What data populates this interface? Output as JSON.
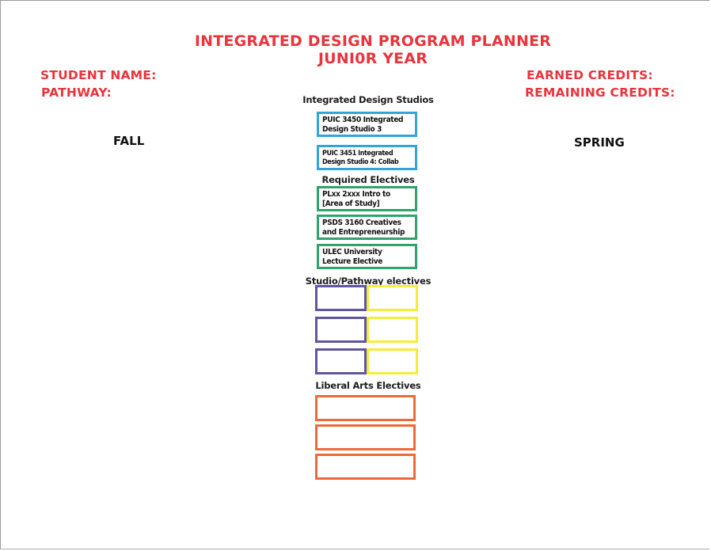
{
  "header": {
    "title": "INTEGRATED DESIGN PROGRAM PLANNER",
    "subtitle": "JUNI0R YEAR"
  },
  "fields": {
    "student_name": "STUDENT NAME:",
    "pathway": "PATHWAY:",
    "earned_credits": "EARNED CREDITS:",
    "remaining_credits": "REMAINING CREDITS:"
  },
  "terms": {
    "fall": "FALL",
    "spring": "SPRING"
  },
  "sections": {
    "studios": {
      "heading": "Integrated Design Studios",
      "courses": [
        "PUIC 3450 Integrated Design Studio 3",
        "PUIC 3451 Integrated Design Studio 4: Collab"
      ]
    },
    "required": {
      "heading": "Required Electives",
      "courses": [
        "PLxx 2xxx Intro to [Area of Study]",
        "PSDS 3160 Creatives and Entrepreneurship",
        "ULEC University Lecture Elective"
      ]
    },
    "studio_pathway": {
      "heading": "Studio/Pathway electives"
    },
    "liberal_arts": {
      "heading": "Liberal Arts Electives"
    }
  },
  "colors": {
    "title_red": "#e8343c",
    "studio_blue": "#32a4da",
    "required_green": "#2fa36b",
    "studio_purple": "#5d56a2",
    "pathway_yellow": "#f6ec3a",
    "liberal_orange": "#ec6a37"
  }
}
